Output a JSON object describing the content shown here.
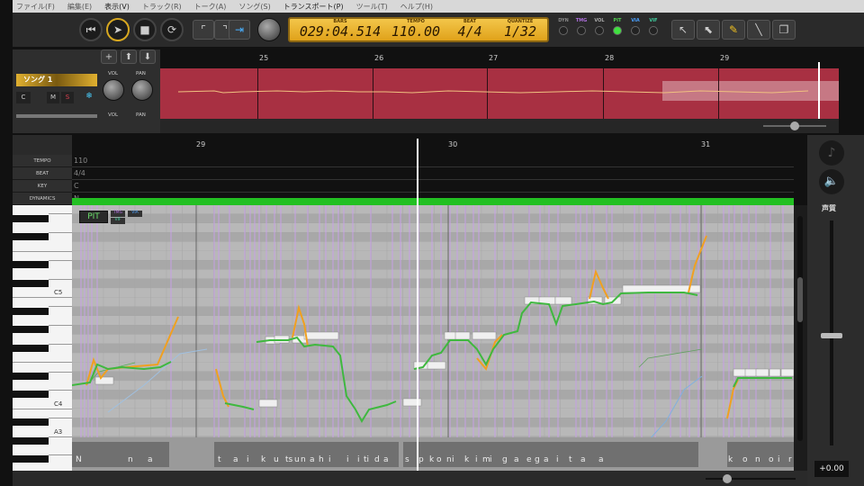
{
  "menu": [
    "ファイル(F)",
    "編集(E)",
    "表示(V)",
    "トラック(R)",
    "トーク(A)",
    "ソング(S)",
    "トランスポート(P)",
    "ツール(T)",
    "ヘルプ(H)"
  ],
  "lcd": {
    "bars_label": "BARS",
    "bars": "029:04.514",
    "tempo_label": "TEMPO",
    "tempo": "110.00",
    "beat_label": "BEAT",
    "beat": "4/4",
    "quantize_label": "QUANTIZE",
    "quantize": "1/32"
  },
  "modes": [
    {
      "label": "DYN",
      "color": "#888888",
      "on": false
    },
    {
      "label": "TMG",
      "color": "#b070e0",
      "on": false
    },
    {
      "label": "VOL",
      "color": "#aaaaaa",
      "on": false
    },
    {
      "label": "PIT",
      "color": "#50d050",
      "on": true
    },
    {
      "label": "VIA",
      "color": "#4aa0ff",
      "on": false
    },
    {
      "label": "VIF",
      "color": "#40d0a0",
      "on": false
    }
  ],
  "track": {
    "name": "ソング 1",
    "c": "C",
    "m": "M",
    "s": "S",
    "vol": "VOL",
    "pan": "PAN"
  },
  "overview_bars": [
    "25",
    "26",
    "27",
    "28",
    "29"
  ],
  "editor_bars": [
    "29",
    "30",
    "31"
  ],
  "rows": [
    {
      "label": "TEMPO",
      "value": "110"
    },
    {
      "label": "BEAT",
      "value": "4/4"
    },
    {
      "label": "KEY",
      "value": "C"
    },
    {
      "label": "DYNAMICS",
      "value": "N"
    }
  ],
  "note_labels": [
    "C5",
    "C4",
    "A3"
  ],
  "param_tabs": {
    "main": "PIT",
    "tmg": "TMG",
    "via": "VIA",
    "vif": "VIF"
  },
  "lyrics": [
    "N",
    "n",
    "a",
    "t",
    "a",
    "i",
    "k",
    "u",
    "ts",
    "u",
    "n",
    "a",
    "h",
    "i",
    "i",
    "i",
    "ti",
    "d",
    "a",
    "s",
    "p",
    "k",
    "o",
    "n",
    "i",
    "k",
    "i",
    "m",
    "i",
    "g",
    "a",
    "e",
    "g",
    "a",
    "i",
    "t",
    "a",
    "a",
    "k",
    "o",
    "n",
    "o",
    "i",
    "r",
    "o"
  ],
  "right": {
    "label": "声質",
    "value": "+0.00"
  }
}
